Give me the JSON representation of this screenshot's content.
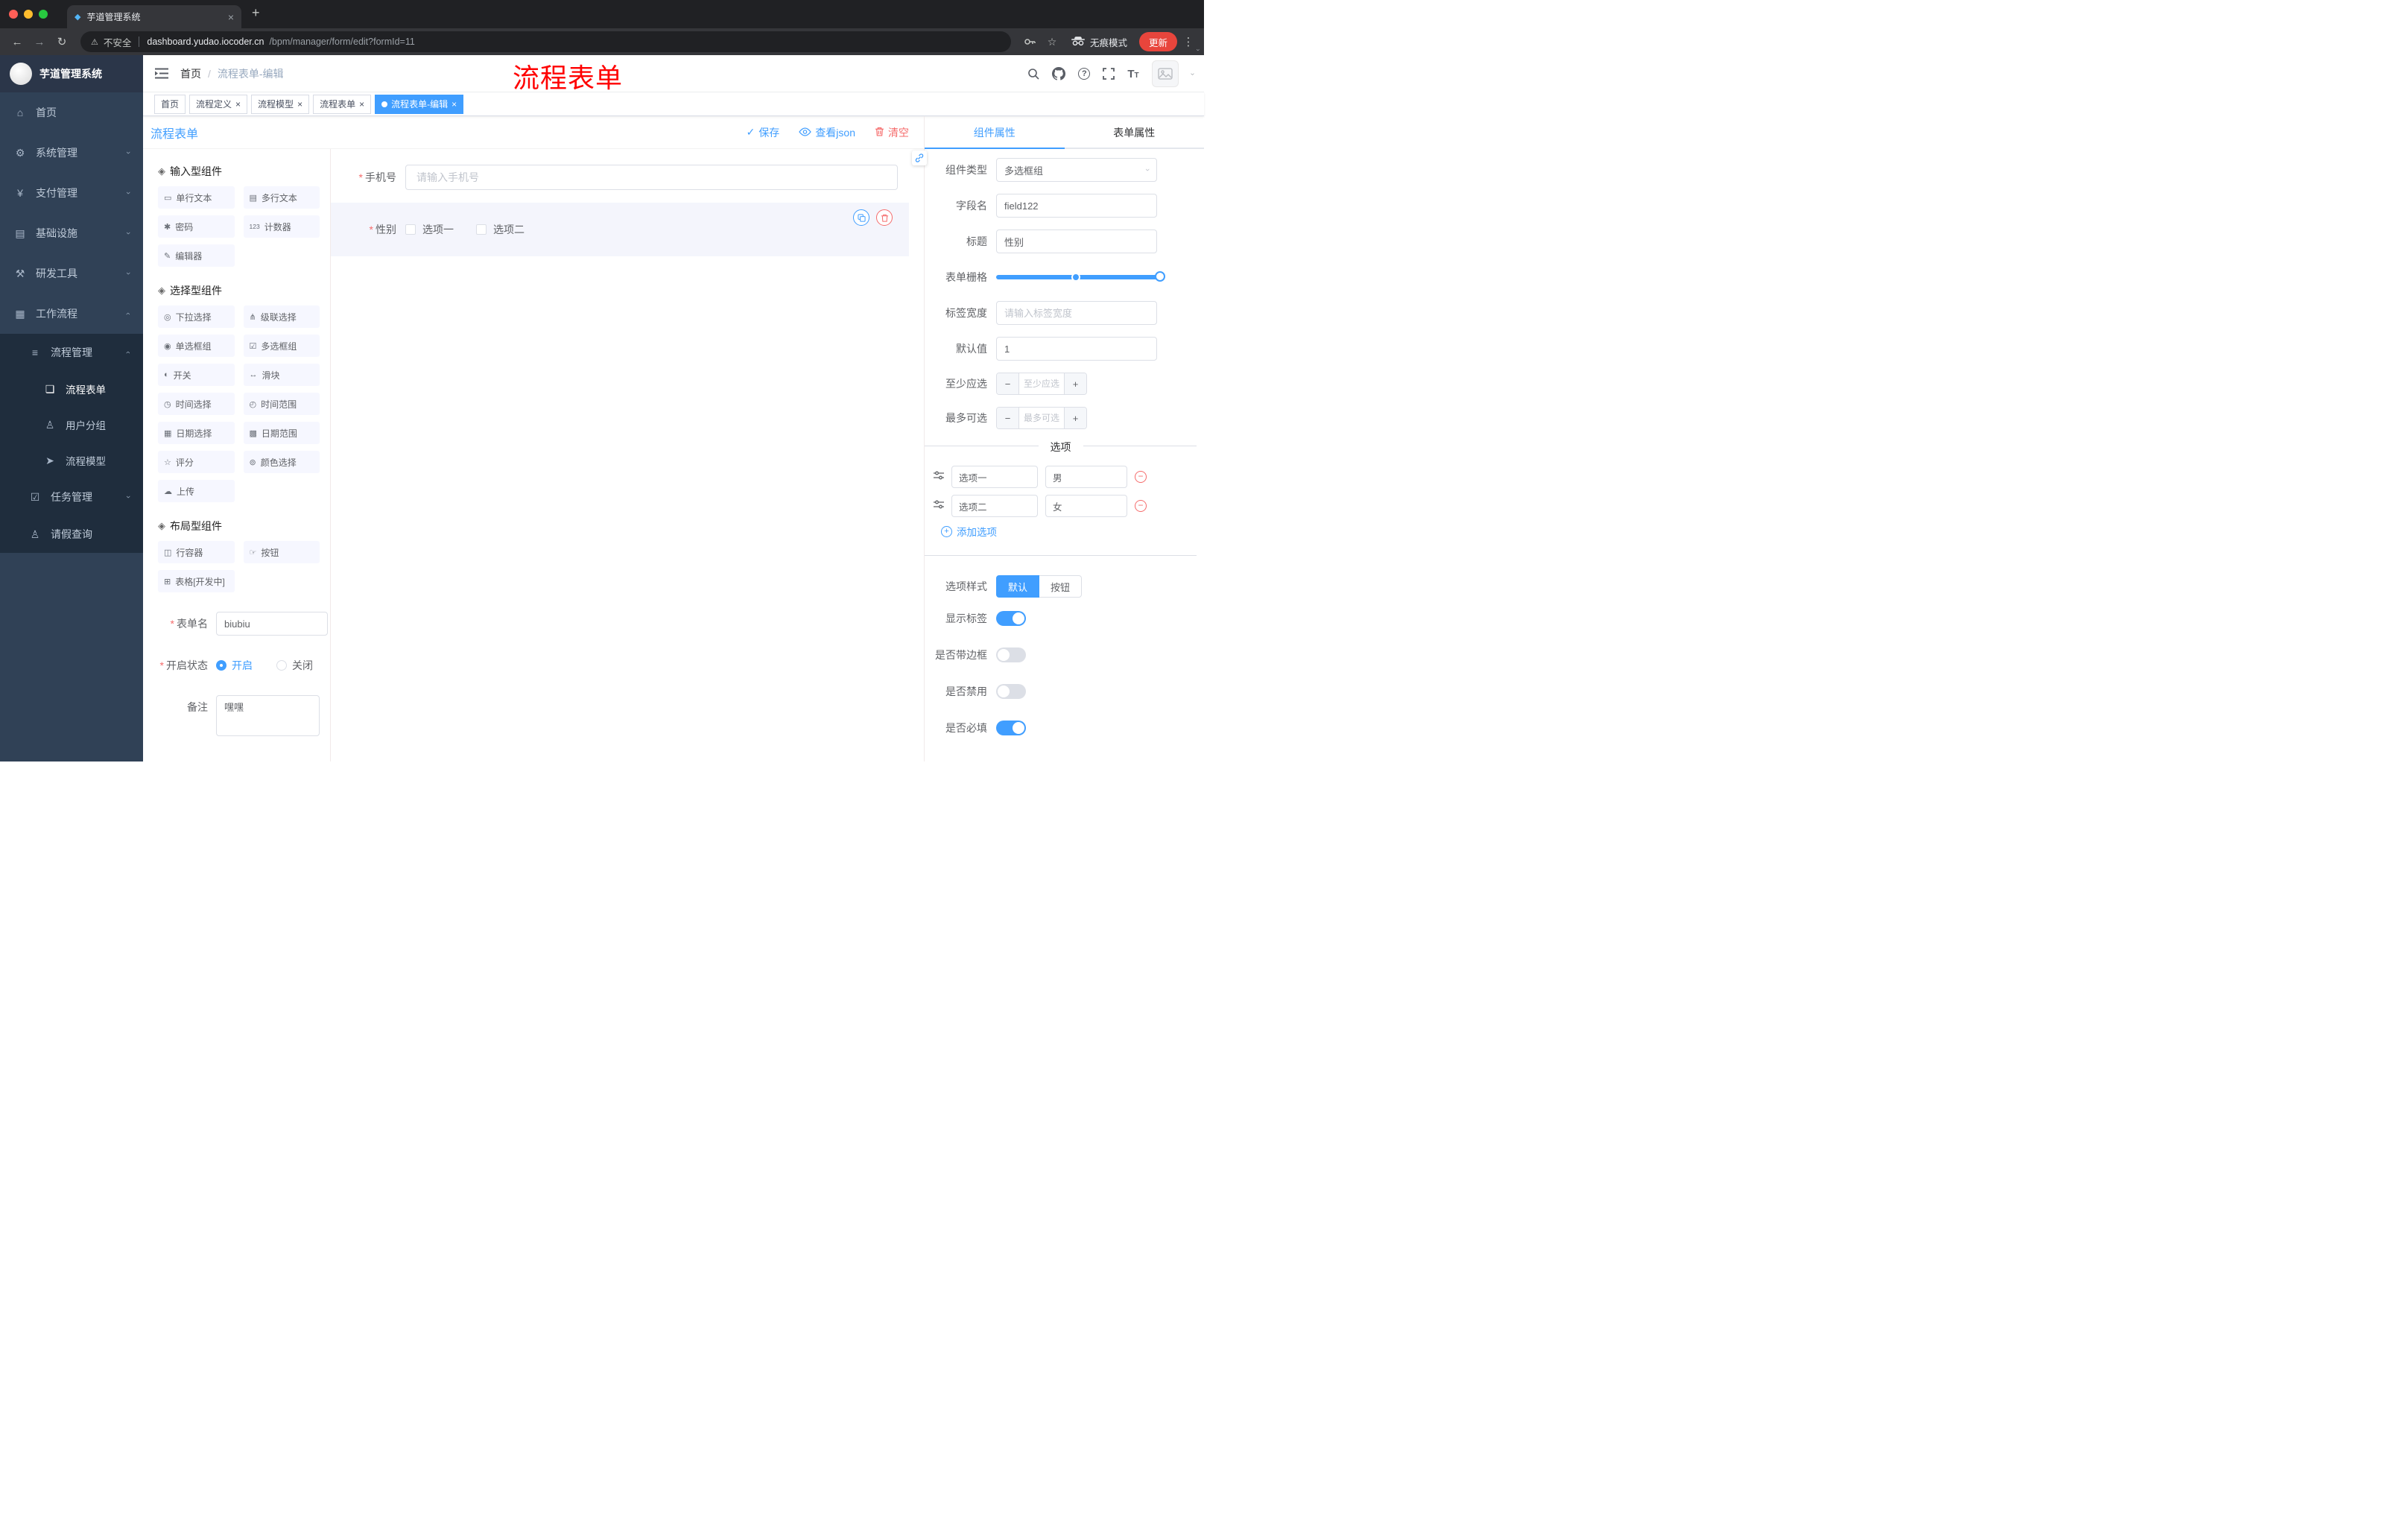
{
  "colors": {
    "accent": "#409eff",
    "danger": "#f56c6c",
    "annotation_red": "#ff0000",
    "sidebar_bg": "#304156",
    "submenu_bg": "#1f2d3d",
    "active_tag": "#409eff"
  },
  "ui": {
    "close_glyph": "×",
    "plus_glyph": "+",
    "dots_glyph": "⋮",
    "back_glyph": "←",
    "forward_glyph": "→",
    "reload_glyph": "↻",
    "star_glyph": "☆",
    "warn_glyph": "⚠",
    "check_glyph": "✓",
    "chevron_glyph": "›",
    "minus_glyph": "−",
    "plus_small_glyph": "+"
  },
  "browser": {
    "tab_title": "芋道管理系统",
    "warning_label": "不安全",
    "url_domain": "dashboard.yudao.iocoder.cn",
    "url_path": "/bpm/manager/form/edit?formId=11",
    "incognito_label": "无痕模式",
    "update_label": "更新"
  },
  "sidebar": {
    "app_title": "芋道管理系统",
    "items": [
      {
        "label": "首页",
        "glyph": "⌂"
      },
      {
        "label": "系统管理",
        "glyph": "⚙"
      },
      {
        "label": "支付管理",
        "glyph": "¥"
      },
      {
        "label": "基础设施",
        "glyph": "▤"
      },
      {
        "label": "研发工具",
        "glyph": "⚒"
      },
      {
        "label": "工作流程",
        "glyph": "▦"
      },
      {
        "label": "流程管理",
        "glyph": "≡"
      },
      {
        "label": "流程表单",
        "glyph": "❏"
      },
      {
        "label": "用户分组",
        "glyph": "♙"
      },
      {
        "label": "流程模型",
        "glyph": "➤"
      },
      {
        "label": "任务管理",
        "glyph": "☑"
      },
      {
        "label": "请假查询",
        "glyph": "♙"
      }
    ]
  },
  "header": {
    "breadcrumb_home": "首页",
    "breadcrumb_sep": "/",
    "breadcrumb_current": "流程表单-编辑",
    "annotation": "流程表单"
  },
  "tags": {
    "items": [
      {
        "label": "首页"
      },
      {
        "label": "流程定义"
      },
      {
        "label": "流程模型"
      },
      {
        "label": "流程表单"
      },
      {
        "label": "流程表单-编辑"
      }
    ]
  },
  "editor": {
    "title": "流程表单",
    "actions": {
      "save": "保存",
      "view_json": "查看json",
      "clear": "清空"
    },
    "palette": {
      "t1": "输入型组件",
      "s1": [
        {
          "label": "单行文本",
          "glyph": "▭"
        },
        {
          "label": "多行文本",
          "glyph": "▤"
        },
        {
          "label": "密码",
          "glyph": "✱"
        },
        {
          "label": "计数器",
          "glyph": "123"
        },
        {
          "label": "编辑器",
          "glyph": "✎"
        }
      ],
      "t2": "选择型组件",
      "s2": [
        {
          "label": "下拉选择",
          "glyph": "◎"
        },
        {
          "label": "级联选择",
          "glyph": "⋔"
        },
        {
          "label": "单选框组",
          "glyph": "◉"
        },
        {
          "label": "多选框组",
          "glyph": "☑"
        },
        {
          "label": "开关",
          "glyph": "◐"
        },
        {
          "label": "滑块",
          "glyph": "↔"
        },
        {
          "label": "时间选择",
          "glyph": "◷"
        },
        {
          "label": "时间范围",
          "glyph": "◴"
        },
        {
          "label": "日期选择",
          "glyph": "▦"
        },
        {
          "label": "日期范围",
          "glyph": "▩"
        },
        {
          "label": "评分",
          "glyph": "☆"
        },
        {
          "label": "颜色选择",
          "glyph": "⊚"
        },
        {
          "label": "上传",
          "glyph": "☁"
        }
      ],
      "t3": "布局型组件",
      "s3": [
        {
          "label": "行容器",
          "glyph": "◫"
        },
        {
          "label": "按钮",
          "glyph": "☞"
        },
        {
          "label": "表格[开发中]",
          "glyph": "⊞"
        }
      ]
    },
    "meta": {
      "form_name_label": "表单名",
      "form_name_value": "biubiu",
      "status_label": "开启状态",
      "status_on": "开启",
      "status_off": "关闭",
      "remark_label": "备注",
      "remark_value": "嘿嘿"
    },
    "canvas": {
      "required_mark": "*",
      "phone_label": "手机号",
      "phone_placeholder": "请输入手机号",
      "gender_label": "性别",
      "gender_option1": "选项一",
      "gender_option2": "选项二"
    }
  },
  "props": {
    "tab_component": "组件属性",
    "tab_form": "表单属性",
    "type_label": "组件类型",
    "type_value": "多选框组",
    "field_label": "字段名",
    "field_value": "field122",
    "title_label": "标题",
    "title_value": "性别",
    "grid_label": "表单栅格",
    "label_width_label": "标签宽度",
    "label_width_placeholder": "请输入标签宽度",
    "default_label": "默认值",
    "default_value": "1",
    "min_label": "至少应选",
    "min_placeholder": "至少应选",
    "max_label": "最多可选",
    "max_placeholder": "最多可选",
    "options_title": "选项",
    "options": [
      {
        "name": "选项一",
        "value": "男"
      },
      {
        "name": "选项二",
        "value": "女"
      }
    ],
    "add_option_label": "添加选项",
    "style_label": "选项样式",
    "style_default": "默认",
    "style_button": "按钮",
    "toggle1_label": "显示标签",
    "toggle2_label": "是否带边框",
    "toggle3_label": "是否禁用",
    "toggle4_label": "是否必填"
  }
}
